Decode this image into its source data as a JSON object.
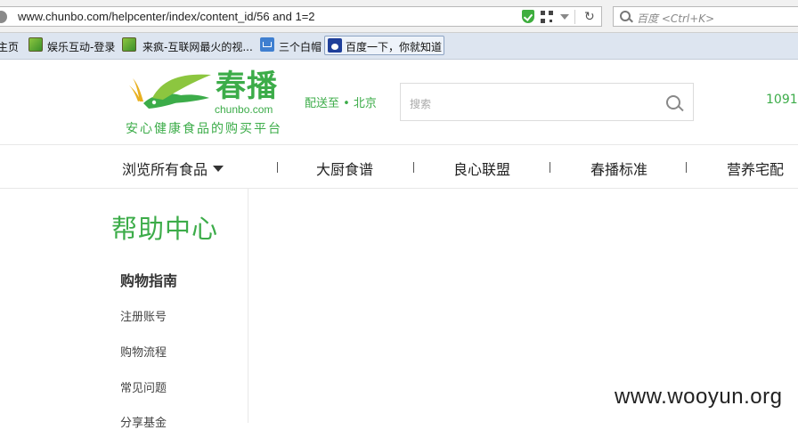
{
  "browser": {
    "url": "www.chunbo.com/helpcenter/index/content_id/56 and 1=2",
    "search_placeholder": "百度 <Ctrl+K>",
    "reload_glyph": "↻"
  },
  "bookmarks": [
    {
      "label": "主页",
      "icon": "home-icon"
    },
    {
      "label": "娱乐互动-登录",
      "icon": "game-icon"
    },
    {
      "label": "来疯-互联网最火的视...",
      "icon": "game-icon"
    },
    {
      "label": "三个白帽",
      "icon": "calendar-icon"
    },
    {
      "label": "百度一下，你就知道",
      "icon": "baidu-paw-icon"
    }
  ],
  "site": {
    "logo_name": "春播",
    "logo_domain": "chunbo.com",
    "logo_slogan": "安心健康食品的购买平台",
    "deliver": "配送至 • 北京",
    "search_placeholder": "搜索",
    "hotline": "1091",
    "brand_color": "#3cac49"
  },
  "nav": {
    "browse_all": "浏览所有食品",
    "items": [
      "大厨食谱",
      "良心联盟",
      "春播标准",
      "营养宅配"
    ]
  },
  "help": {
    "title": "帮助中心",
    "section": "购物指南",
    "links": [
      "注册账号",
      "购物流程",
      "常见问题",
      "分享基金"
    ]
  },
  "watermark": "www.wooyun.org"
}
